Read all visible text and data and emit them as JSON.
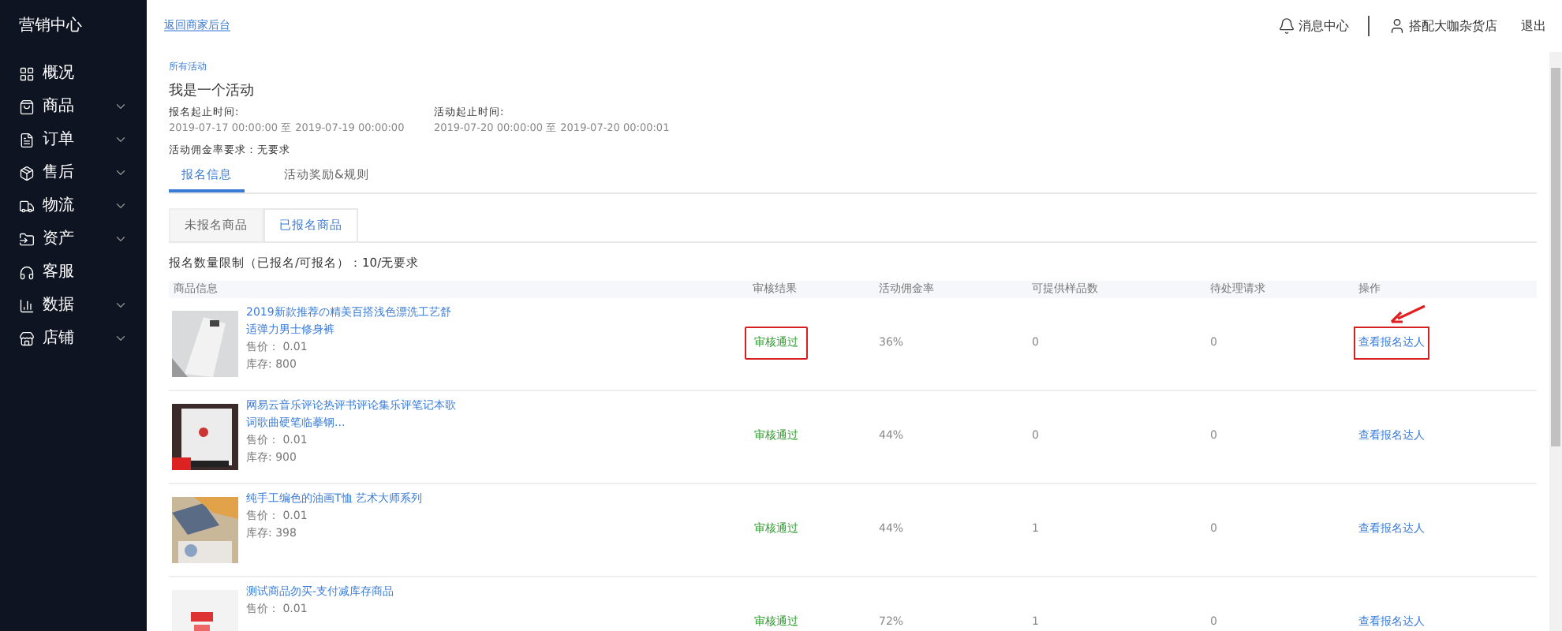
{
  "sidebar": {
    "title": "营销中心",
    "items": [
      {
        "label": "概况",
        "expandable": false
      },
      {
        "label": "商品",
        "expandable": true
      },
      {
        "label": "订单",
        "expandable": true
      },
      {
        "label": "售后",
        "expandable": true
      },
      {
        "label": "物流",
        "expandable": true
      },
      {
        "label": "资产",
        "expandable": true
      },
      {
        "label": "客服",
        "expandable": false
      },
      {
        "label": "数据",
        "expandable": true
      },
      {
        "label": "店铺",
        "expandable": true
      }
    ]
  },
  "header": {
    "back_link": "返回商家后台",
    "notifications": "消息中心",
    "user": "搭配大咖杂货店",
    "logout": "退出"
  },
  "breadcrumb": "所有活动",
  "activity": {
    "title": "我是一个活动",
    "signup_label": "报名起止时间:",
    "signup_range": "2019-07-17 00:00:00 至 2019-07-19 00:00:00",
    "active_label": "活动起止时间:",
    "active_range": "2019-07-20 00:00:00 至 2019-07-20 00:00:01",
    "commission_req": "活动佣金率要求：无要求"
  },
  "tabs": [
    {
      "label": "报名信息",
      "selected": true
    },
    {
      "label": "活动奖励&规则",
      "selected": false
    }
  ],
  "subtabs": [
    {
      "label": "未报名商品",
      "selected": false
    },
    {
      "label": "已报名商品",
      "selected": true
    }
  ],
  "limit": "报名数量限制（已报名/可报名）：10/无要求",
  "table": {
    "columns": [
      "商品信息",
      "审核结果",
      "活动佣金率",
      "可提供样品数",
      "待处理请求",
      "操作"
    ],
    "rows": [
      {
        "title": "2019新款推荐の精美百搭浅色漂洗工艺舒适弹力男士修身裤",
        "price": "售价：  0.01",
        "stock": "库存: 800",
        "status": "审核通过",
        "rate": "36%",
        "samples": "0",
        "requests": "0",
        "action": "查看报名达人",
        "highlighted": true
      },
      {
        "title": "网易云音乐评论热评书评论集乐评笔记本歌词歌曲硬笔临摹钢...",
        "price": "售价：  0.01",
        "stock": "库存: 900",
        "status": "审核通过",
        "rate": "44%",
        "samples": "0",
        "requests": "0",
        "action": "查看报名达人",
        "highlighted": false
      },
      {
        "title": "纯手工编色的油画T恤 艺术大师系列",
        "price": "售价：  0.01",
        "stock": "库存: 398",
        "status": "审核通过",
        "rate": "44%",
        "samples": "1",
        "requests": "0",
        "action": "查看报名达人",
        "highlighted": false
      },
      {
        "title": "测试商品勿买-支付减库存商品",
        "price": "售价：  0.01",
        "status": "审核通过",
        "rate": "72%",
        "samples": "1",
        "requests": "0",
        "action": "查看报名达人",
        "highlighted": false
      }
    ]
  }
}
